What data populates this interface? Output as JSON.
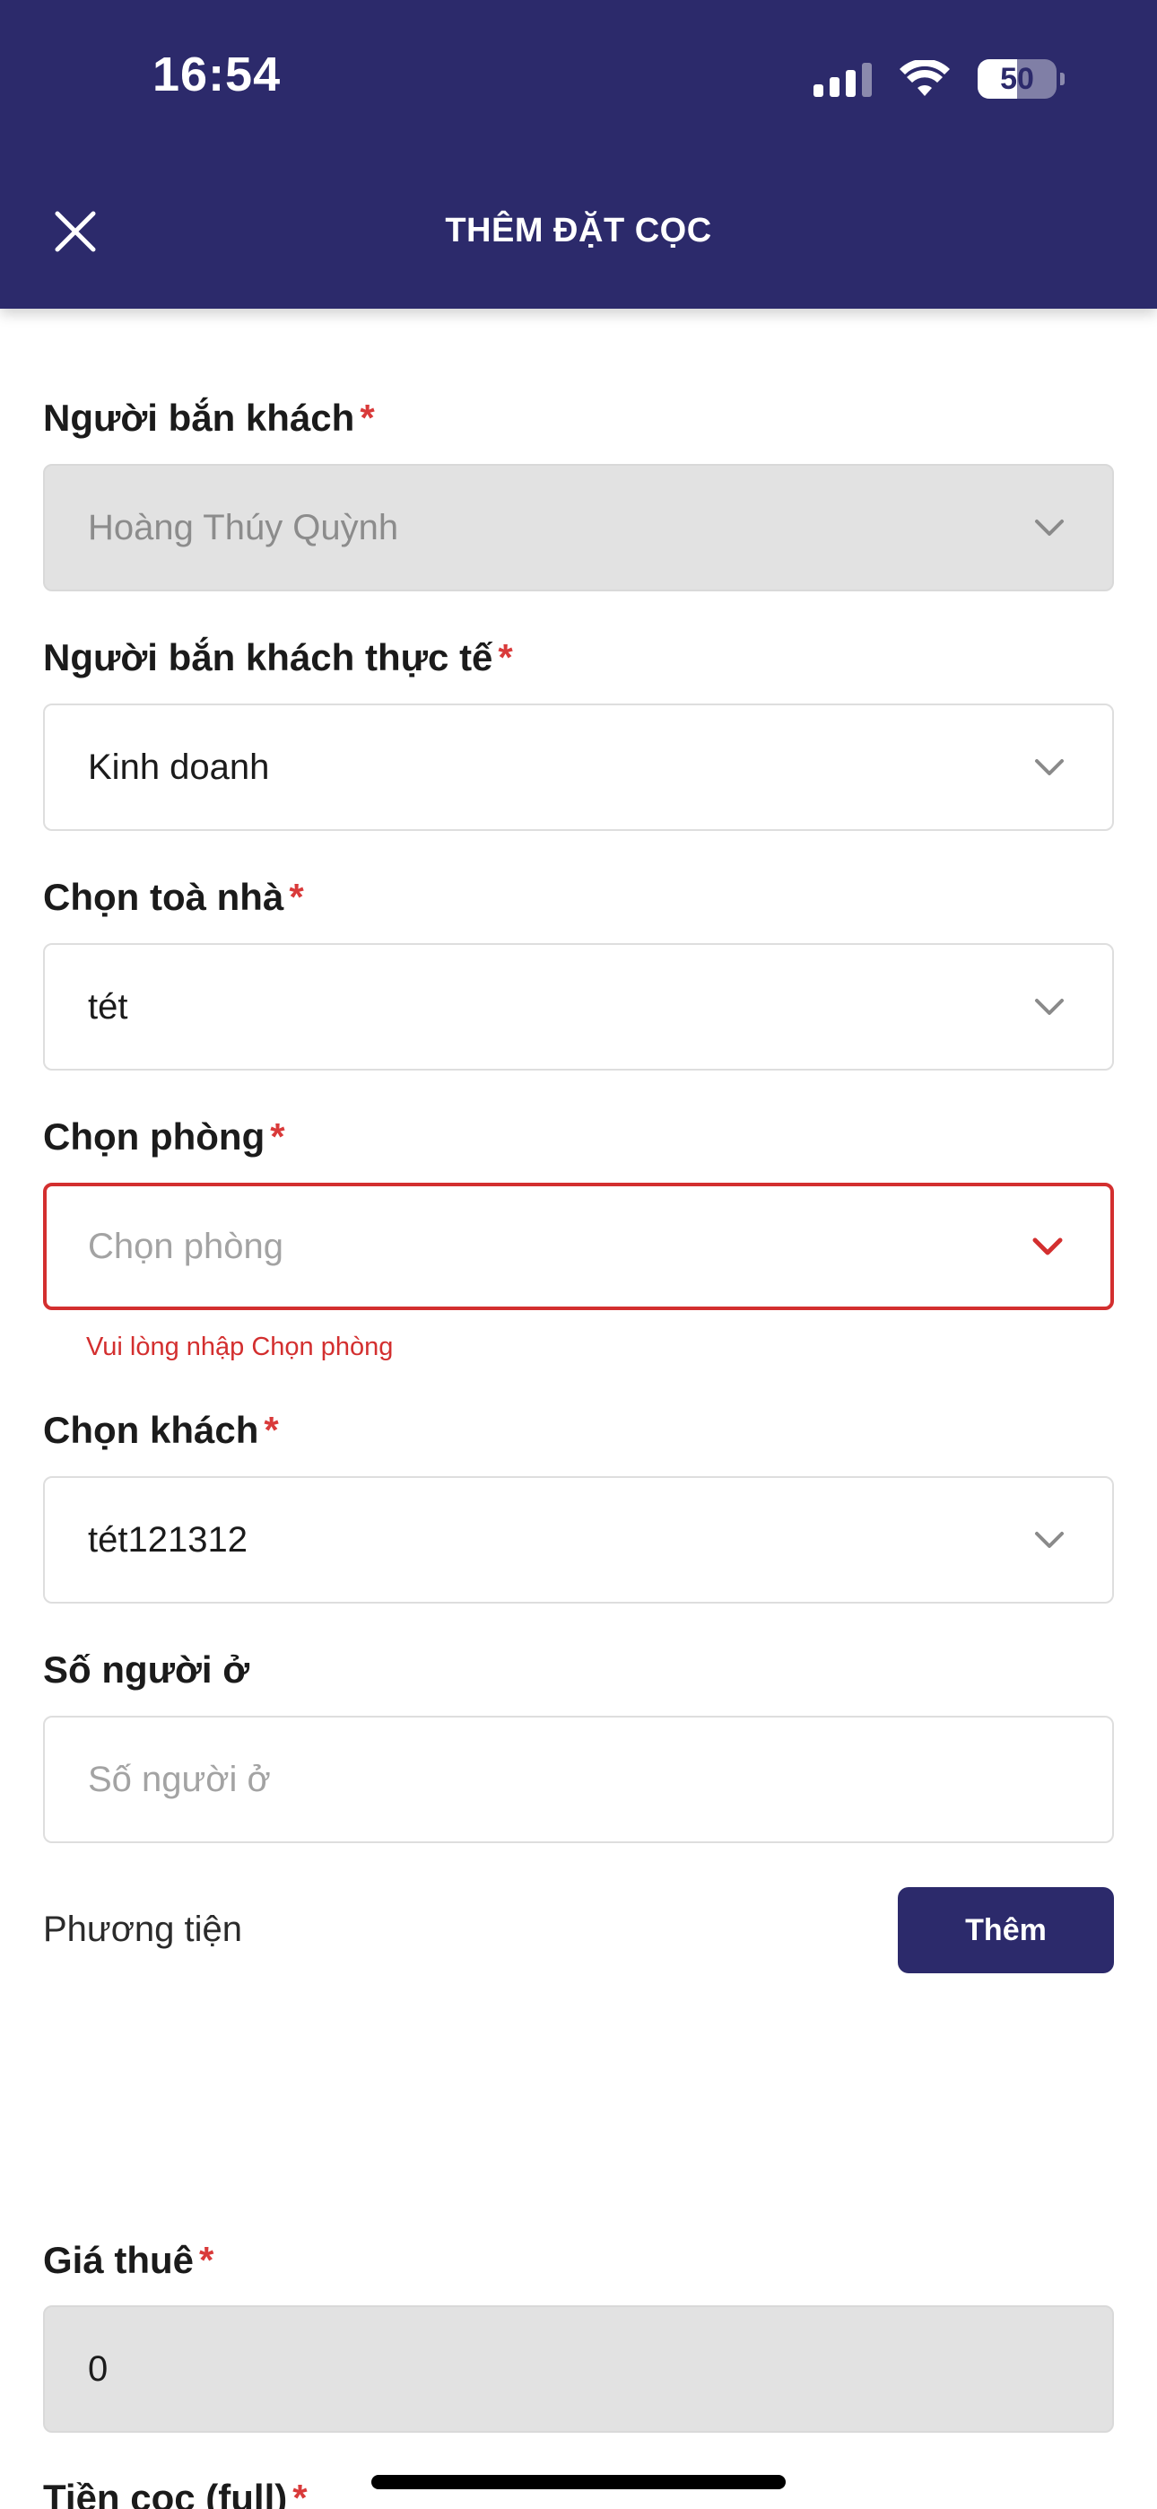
{
  "status_bar": {
    "time": "16:54",
    "battery": "50"
  },
  "header": {
    "title": "THÊM ĐẶT CỌC",
    "close_icon": "close-icon"
  },
  "form": {
    "required_mark": "*",
    "fields": [
      {
        "label": "Người bắn khách",
        "value": "Hoàng Thúy Quỳnh",
        "required": true,
        "disabled": true
      },
      {
        "label": "Người bắn khách thực tế",
        "value": "Kinh doanh",
        "required": true
      },
      {
        "label": "Chọn toà nhà",
        "value": "tét",
        "required": true
      },
      {
        "label": "Chọn phòng",
        "placeholder": "Chọn phòng",
        "required": true,
        "error": "Vui lòng nhập Chọn phòng"
      },
      {
        "label": "Chọn khách",
        "value": "tét121312",
        "required": true
      },
      {
        "label": "Số người ở",
        "placeholder": "Số người ở",
        "required": false
      }
    ],
    "vehicle": {
      "label": "Phương tiện",
      "add_button": "Thêm"
    },
    "rent": {
      "label": "Giá thuê",
      "value": "0",
      "required": true
    },
    "deposit": {
      "label": "Tiền cọc (full)",
      "required": true
    }
  },
  "colors": {
    "primary": "#2c2a6b",
    "error": "#d32f2f",
    "required": "#d93a3a",
    "disabled_bg": "#e2e2e2"
  }
}
